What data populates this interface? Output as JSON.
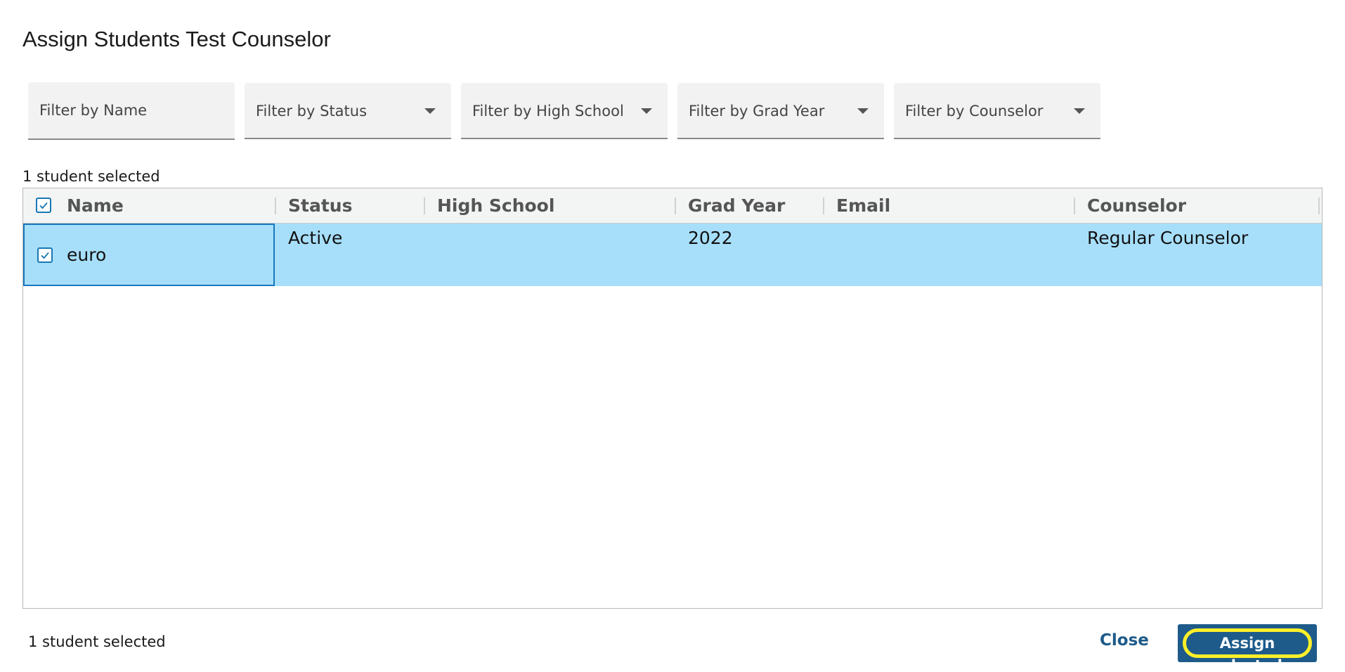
{
  "dialog": {
    "title": "Assign Students Test Counselor"
  },
  "filters": {
    "name_placeholder": "Filter by Name",
    "status": "Filter by Status",
    "high_school": "Filter by High School",
    "grad_year": "Filter by Grad Year",
    "counselor": "Filter by Counselor"
  },
  "selection": {
    "top_count": "1 student selected",
    "bottom_count": "1 student selected"
  },
  "table": {
    "headers": {
      "name": "Name",
      "status": "Status",
      "high_school": "High School",
      "grad_year": "Grad Year",
      "email": "Email",
      "counselor": "Counselor"
    },
    "rows": [
      {
        "name": "euro",
        "status": "Active",
        "high_school": "",
        "grad_year": "2022",
        "email": "",
        "counselor": "Regular Counselor",
        "selected": true
      }
    ]
  },
  "actions": {
    "close": "Close",
    "assign": "Assign selected"
  },
  "colors": {
    "accent": "#1e5b8a",
    "selected_row": "#a7dffa",
    "focus_ring": "#ffef29",
    "checkbox": "#1778b5"
  }
}
